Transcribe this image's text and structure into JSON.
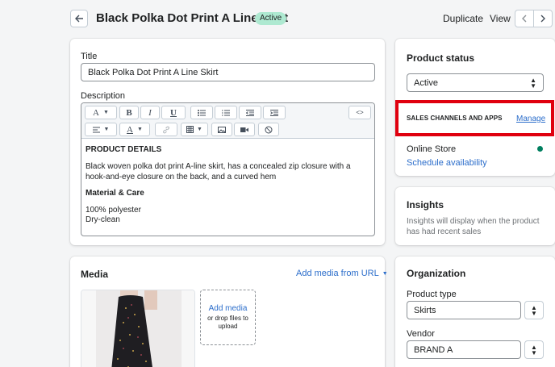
{
  "header": {
    "title": "Black Polka Dot Print A Line Skirt",
    "status_badge": "Active",
    "duplicate_label": "Duplicate",
    "view_label": "View"
  },
  "product": {
    "title_label": "Title",
    "title_value": "Black Polka Dot Print A Line Skirt",
    "description_label": "Description",
    "description": {
      "heading": "PRODUCT DETAILS",
      "paragraph": "Black woven polka dot print A-line skirt, has a concealed zip closure with a hook-and-eye closure on the back, and a curved hem",
      "subheading": "Material & Care",
      "line1": "100% polyester",
      "line2": "Dry-clean"
    },
    "toolbar": {
      "font": "A",
      "bold": "B",
      "italic": "I",
      "underline": "U",
      "color": "A",
      "code": "<>"
    }
  },
  "media": {
    "title": "Media",
    "add_from_url": "Add media from URL",
    "add_media": "Add media",
    "drop_hint": "or drop files to upload"
  },
  "status": {
    "title": "Product status",
    "selected": "Active",
    "sales_channels_label": "SALES CHANNELS AND APPS",
    "manage_label": "Manage",
    "online_store": "Online Store",
    "schedule": "Schedule availability",
    "online_dot_color": "#007f5f",
    "highlight_color": "#e0000f"
  },
  "insights": {
    "title": "Insights",
    "text": "Insights will display when the product has had recent sales"
  },
  "organization": {
    "title": "Organization",
    "product_type_label": "Product type",
    "product_type_value": "Skirts",
    "vendor_label": "Vendor",
    "vendor_value": "BRAND A"
  }
}
